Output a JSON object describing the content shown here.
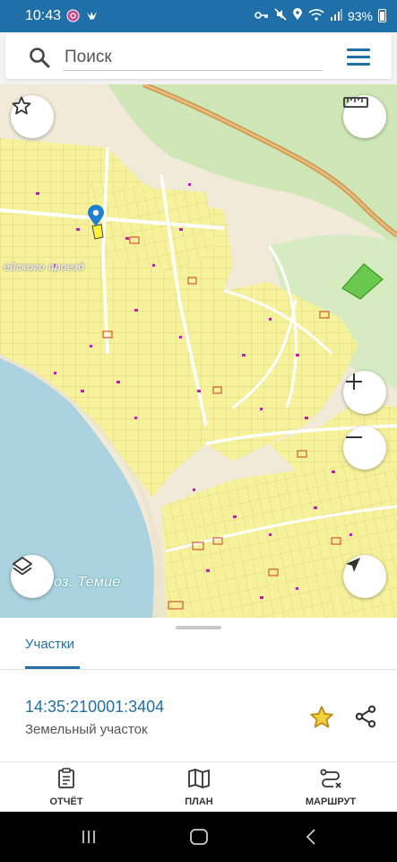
{
  "status_bar": {
    "time": "10:43",
    "battery": "93%",
    "left_icons": [
      "app-notification-icon",
      "bird-icon"
    ],
    "right_icons": [
      "key-icon",
      "mute-icon",
      "location-icon",
      "wifi-icon",
      "signal-icon",
      "battery-icon"
    ]
  },
  "search": {
    "placeholder": "Поиск"
  },
  "map": {
    "street_label": "ейского проезд",
    "water_label": "оз. Темие",
    "colors": {
      "land": "#f1ead9",
      "parcel": "#f6f29c",
      "forest": "#cfe6b6",
      "water": "#aad3df",
      "road": "#cf9a57",
      "marker": "#1f7fd0",
      "selected_parcel": "#5ec442",
      "building": "#c020b0"
    }
  },
  "sheet": {
    "tab_label": "Участки",
    "parcel_id": "14:35:210001:3404",
    "parcel_type": "Земельный участок"
  },
  "bottom_nav": {
    "report": "ОТЧЁТ",
    "plan": "ПЛАН",
    "route": "МАРШРУТ"
  },
  "accent_color": "#1f6fa8"
}
